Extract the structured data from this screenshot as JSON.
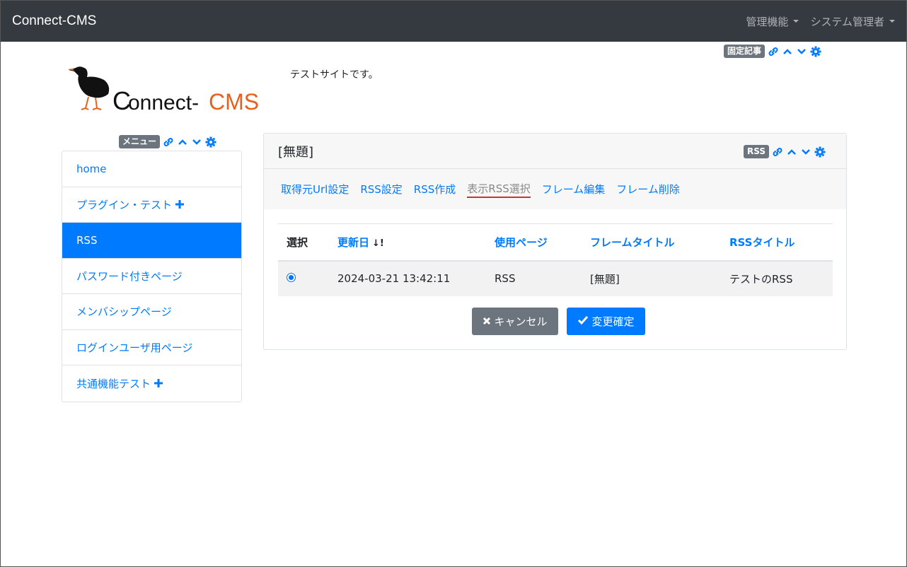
{
  "navbar": {
    "brand": "Connect-CMS",
    "admin_menu": "管理機能",
    "user_menu": "システム管理者"
  },
  "header": {
    "badge": "固定記事",
    "site_description": "テストサイトです。",
    "logo_text": "Connect-CMS"
  },
  "sidebar": {
    "badge": "メニュー",
    "items": [
      {
        "label": "home"
      },
      {
        "label": "プラグイン・テスト"
      },
      {
        "label": "RSS"
      },
      {
        "label": "パスワード付きページ"
      },
      {
        "label": "メンバシップページ"
      },
      {
        "label": "ログインユーザ用ページ"
      },
      {
        "label": "共通機能テスト"
      }
    ]
  },
  "card": {
    "title": "[無題]",
    "badge": "RSS",
    "tabs": [
      "取得元Url設定",
      "RSS設定",
      "RSS作成",
      "表示RSS選択",
      "フレーム編集",
      "フレーム削除"
    ],
    "table": {
      "headers": [
        "選択",
        "更新日",
        "使用ページ",
        "フレームタイトル",
        "RSSタイトル"
      ],
      "rows": [
        {
          "updated": "2024-03-21 13:42:11",
          "page": "RSS",
          "frame_title": "[無題]",
          "rss_title": "テストのRSS"
        }
      ]
    },
    "cancel_label": "キャンセル",
    "confirm_label": "変更確定"
  },
  "colors": {
    "primary": "#007bff",
    "navbar": "#343a40",
    "badge": "#6c757d"
  }
}
